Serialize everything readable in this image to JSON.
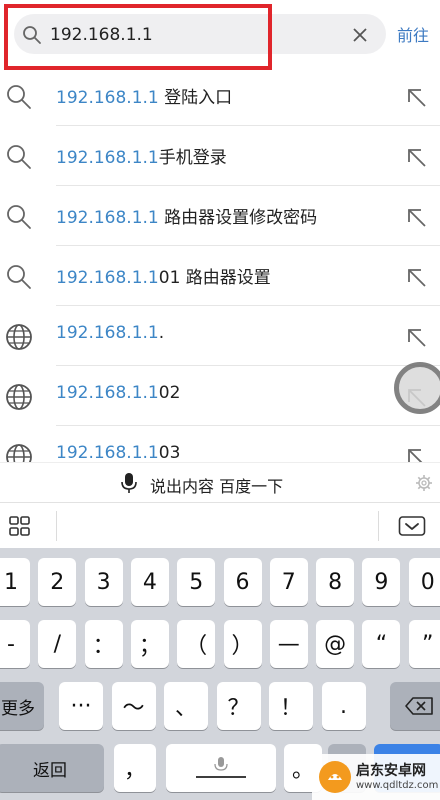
{
  "search": {
    "value": "192.168.1.1",
    "go_label": "前往"
  },
  "suggestions": [
    {
      "query": "192.168.1.1",
      "rest": " 登陆入口",
      "icon": "search-icon"
    },
    {
      "query": "192.168.1.1",
      "rest": "手机登录",
      "icon": "search-icon"
    },
    {
      "query": "192.168.1.1",
      "rest": " 路由器设置修改密码",
      "icon": "search-icon"
    },
    {
      "query": "192.168.1.1",
      "rest": "01 路由器设置",
      "icon": "search-icon"
    },
    {
      "query": "192.168.1.1",
      "rest": ".",
      "icon": "globe-icon"
    },
    {
      "query": "192.168.1.1",
      "rest": "02",
      "icon": "globe-icon"
    },
    {
      "query": "192.168.1.1",
      "rest": "03",
      "icon": "globe-icon"
    }
  ],
  "voice": {
    "label": "说出内容 百度一下"
  },
  "keyboard": {
    "row1": [
      "1",
      "2",
      "3",
      "4",
      "5",
      "6",
      "7",
      "8",
      "9",
      "0"
    ],
    "row2": [
      "-",
      "/",
      "：",
      "；",
      "（",
      "）",
      "—",
      "@",
      "“",
      "”"
    ],
    "row3_left": "更多",
    "row3": [
      "···",
      "～",
      "、",
      "？",
      "！",
      "."
    ],
    "row4_left": "返回",
    "row4_comma": "，",
    "row4_period": "。"
  },
  "watermark": {
    "name": "启东安卓网",
    "url": "www.qdltdz.com"
  },
  "colors": {
    "accent": "#3d86c6",
    "highlight": "#e0252b",
    "keyboard_bg": "#d2d5db"
  }
}
